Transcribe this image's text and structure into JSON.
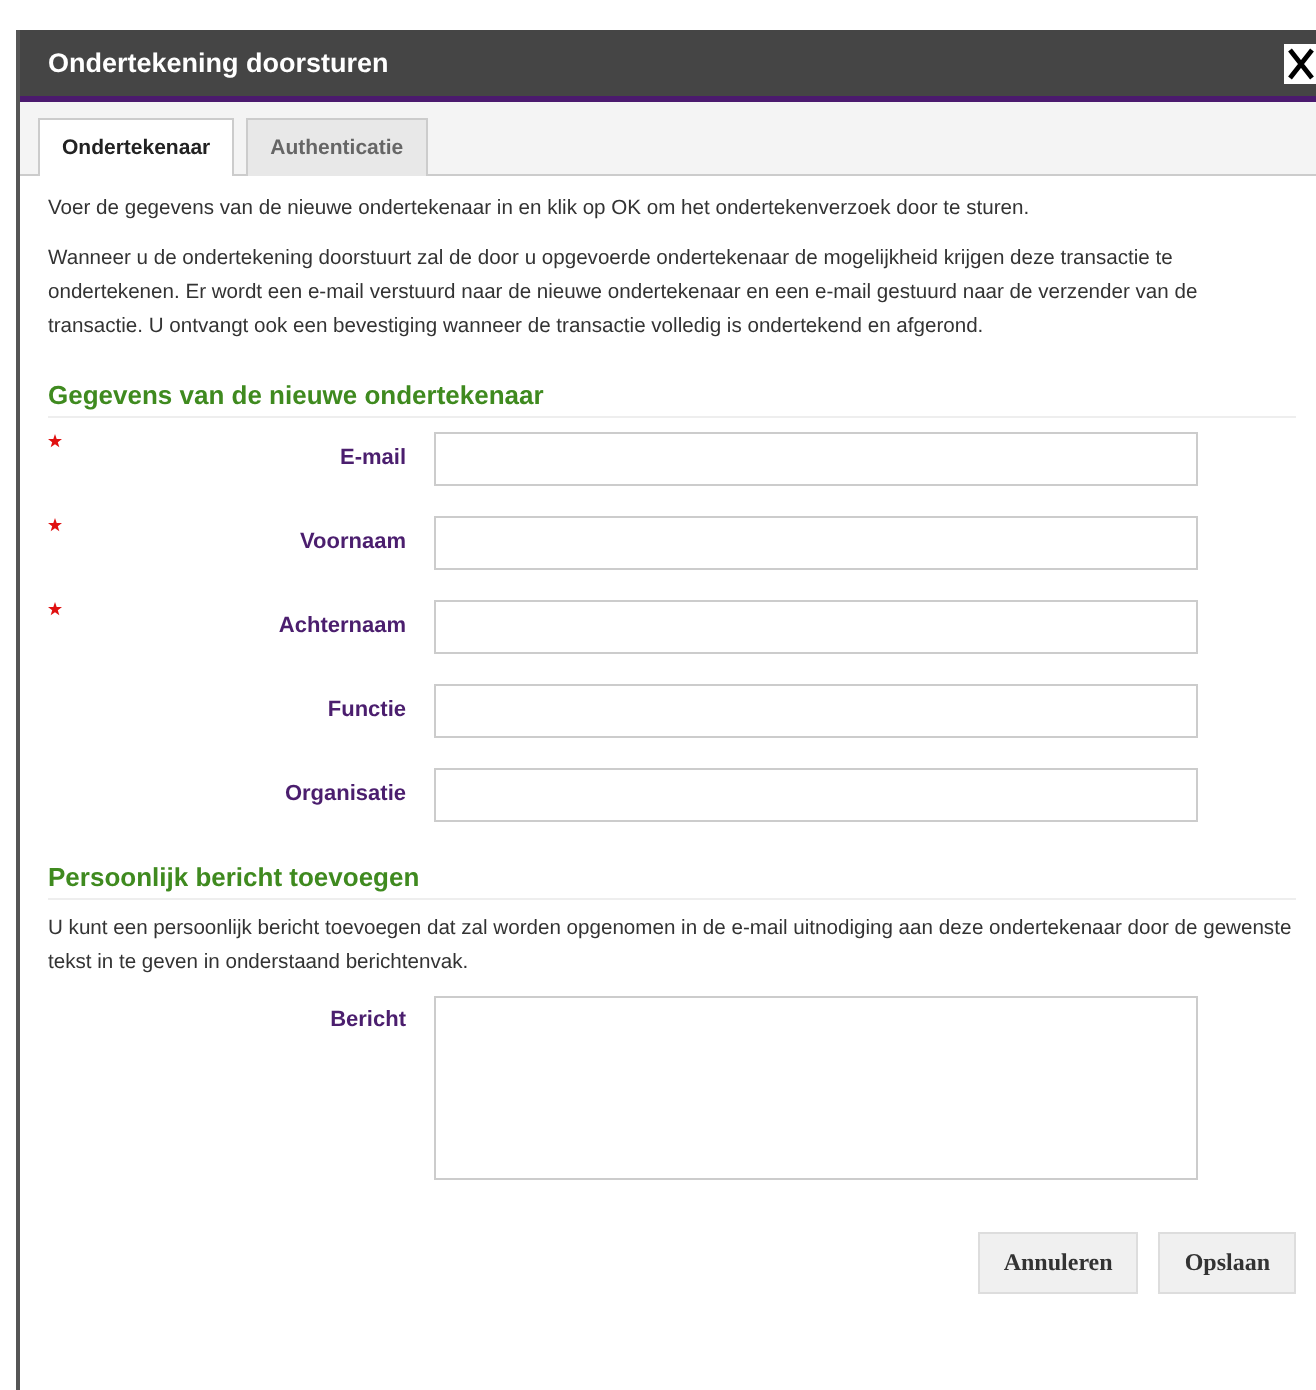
{
  "window": {
    "title": "Ondertekening doorsturen"
  },
  "tabs": [
    {
      "label": "Ondertekenaar",
      "selected": true
    },
    {
      "label": "Authenticatie",
      "selected": false
    }
  ],
  "intro": [
    "Voer de gegevens van de nieuwe ondertekenaar in en klik op OK om het ondertekenverzoek door te sturen.",
    "Wanneer u de ondertekening doorstuurt zal de door u opgevoerde ondertekenaar de mogelijkheid krijgen deze transactie te ondertekenen. Er wordt een e-mail verstuurd naar de nieuwe ondertekenaar en een e-mail gestuurd naar de verzender van de transactie. U ontvangt ook een bevestiging wanneer de transactie volledig is ondertekend en afgerond."
  ],
  "signer_section": {
    "heading": "Gegevens van de nieuwe ondertekenaar",
    "fields": [
      {
        "label": "E-mail",
        "required": true
      },
      {
        "label": "Voornaam",
        "required": true
      },
      {
        "label": "Achternaam",
        "required": true
      },
      {
        "label": "Functie",
        "required": false
      },
      {
        "label": "Organisatie",
        "required": false
      }
    ]
  },
  "message_section": {
    "heading": "Persoonlijk bericht toevoegen",
    "description": "U kunt een persoonlijk bericht toevoegen dat zal worden opgenomen in de e-mail uitnodiging aan deze ondertekenaar door de gewenste tekst in te geven in onderstaand berichtenvak.",
    "field_label": "Bericht"
  },
  "buttons": [
    "Annuleren",
    "Opslaan"
  ]
}
